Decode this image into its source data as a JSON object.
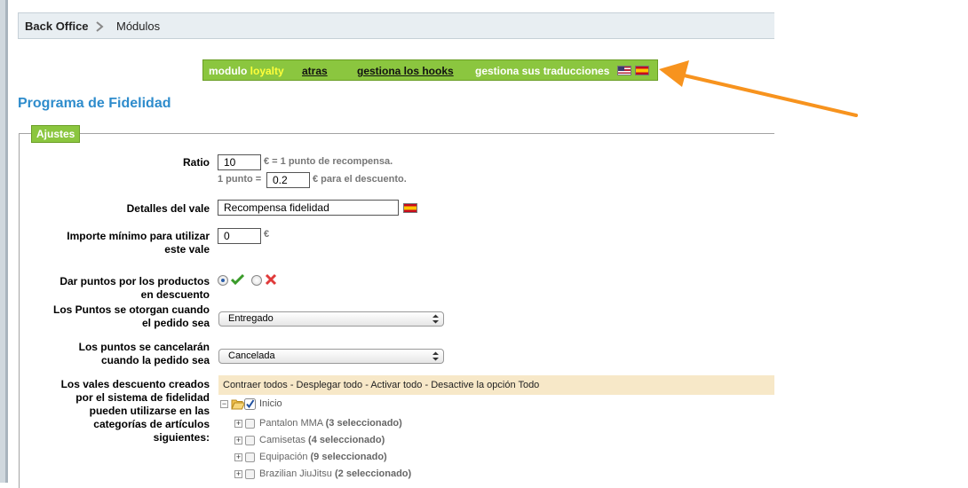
{
  "breadcrumb": {
    "home": "Back Office",
    "current": "Módulos"
  },
  "module_bar": {
    "title_prefix": "modulo",
    "title_name": "loyalty",
    "back_link": "atras",
    "hooks_link": "gestiona los hooks",
    "translations_link": "gestiona sus traducciones",
    "flags": [
      "us-flag-icon",
      "es-flag-icon"
    ]
  },
  "page": {
    "title": "Programa de Fidelidad"
  },
  "settings": {
    "legend": "Ajustes",
    "ratio": {
      "label": "Ratio",
      "value": "10",
      "suffix": "€ = 1 punto de recompensa.",
      "point_prefix": "1 punto =",
      "point_value": "0.2",
      "point_suffix": "€ para el descuento."
    },
    "voucher_details": {
      "label": "Detalles del vale",
      "value": "Recompensa fidelidad"
    },
    "min_amount": {
      "label_line1": "Importe mínimo para utilizar",
      "label_line2": "este vale",
      "value": "0",
      "suffix": "€"
    },
    "discounted_points": {
      "label_line1": "Dar puntos por los productos",
      "label_line2": "en descuento",
      "selected": "yes"
    },
    "points_awarded": {
      "label_line1": "Los Puntos se otorgan cuando",
      "label_line2": "el pedido sea",
      "selected": "Entregado"
    },
    "points_cancelled": {
      "label_line1": "Los puntos se cancelarán",
      "label_line2": "cuando la pedido sea",
      "selected": "Cancelada"
    },
    "categories": {
      "label_lines": [
        "Los vales descuento creados",
        "por el sistema de fidelidad",
        "pueden utilizarse en las",
        "categorías de artículos",
        "siguientes:"
      ],
      "toolbar": {
        "collapse": "Contraer todos",
        "expand": "Desplegar todo",
        "activate": "Activar todo",
        "deactivate": "Desactive la opción Todo",
        "separator": " - "
      },
      "root": {
        "name": "Inicio",
        "checked": true
      },
      "items": [
        {
          "name": "Pantalon MMA",
          "count": "(3 seleccionado)"
        },
        {
          "name": "Camisetas",
          "count": "(4 seleccionado)"
        },
        {
          "name": "Equipación",
          "count": "(9 seleccionado)"
        },
        {
          "name": "Brazilian JiuJitsu",
          "count": "(2 seleccionado)"
        }
      ]
    }
  },
  "colors": {
    "accent_green": "#8bc63f",
    "title_blue": "#2e8ccc",
    "arrow_orange": "#f7931e",
    "toolbar_bg": "#f7e8c8"
  }
}
